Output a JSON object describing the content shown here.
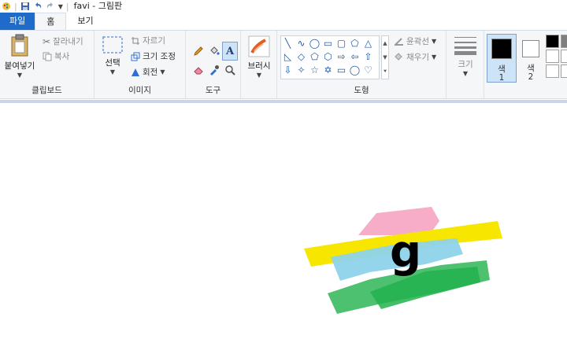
{
  "window": {
    "title": "favi - 그림판"
  },
  "tabs": [
    {
      "label": "파일"
    },
    {
      "label": "홈"
    },
    {
      "label": "보기"
    }
  ],
  "clipboard": {
    "paste_label": "붙여넣기",
    "cut_label": "잘라내기",
    "copy_label": "복사",
    "group_label": "클립보드"
  },
  "image": {
    "select_label": "선택",
    "crop_label": "자르기",
    "resize_label": "크기 조정",
    "rotate_label": "회전",
    "group_label": "이미지"
  },
  "tools": {
    "group_label": "도구"
  },
  "brushes": {
    "label": "브러시"
  },
  "shapes": {
    "outline_label": "윤곽선",
    "fill_label": "채우기",
    "group_label": "도형"
  },
  "size": {
    "label": "크기"
  },
  "colors": {
    "color1_label": "색",
    "color1_num": "1",
    "color2_label": "색",
    "color2_num": "2",
    "color1": "#000000",
    "color2": "#ffffff"
  },
  "drawing": {
    "text": "g",
    "stroke_colors": [
      "#f7a8c4",
      "#f7e600",
      "#8ed3ea",
      "#22b14c"
    ]
  }
}
